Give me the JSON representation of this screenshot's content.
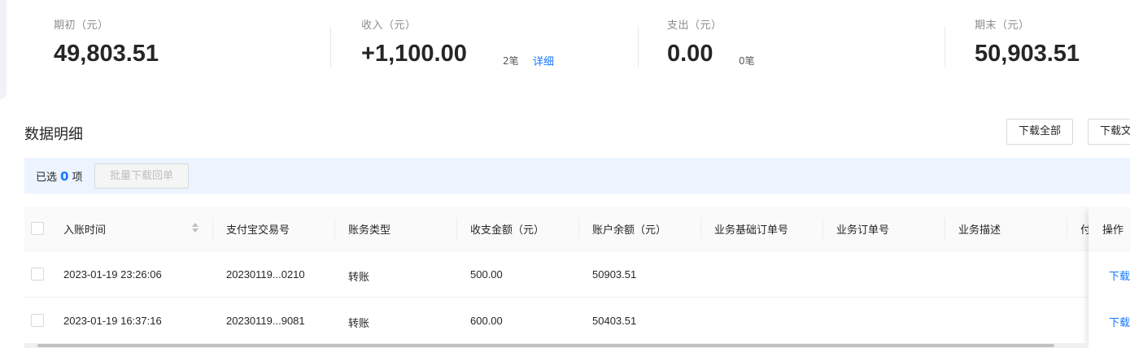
{
  "summary": {
    "opening": {
      "label": "期初（元）",
      "value": "49,803.51"
    },
    "income": {
      "label": "收入（元）",
      "value": "+1,100.00",
      "count": "2笔",
      "detail_link": "详细"
    },
    "expense": {
      "label": "支出（元）",
      "value": "0.00",
      "count": "0笔"
    },
    "closing": {
      "label": "期末（元）",
      "value": "50,903.51"
    }
  },
  "section": {
    "title": "数据明细",
    "download_all": "下载全部",
    "download_file": "下载文"
  },
  "selection": {
    "prefix": "已选",
    "count": "0",
    "suffix": "项",
    "batch_download": "批量下载回单"
  },
  "table": {
    "columns": [
      "入账时间",
      "支付宝交易号",
      "账务类型",
      "收支金额（元）",
      "账户余额（元）",
      "业务基础订单号",
      "业务订单号",
      "业务描述",
      "付",
      "操作"
    ],
    "rows": [
      {
        "time": "2023-01-19 23:26:06",
        "trade_no": "20230119...0210",
        "type": "转账",
        "amount": "500.00",
        "balance": "50903.51",
        "base_order": "",
        "order": "",
        "desc": "",
        "action": "下载"
      },
      {
        "time": "2023-01-19 16:37:16",
        "trade_no": "20230119...9081",
        "type": "转账",
        "amount": "600.00",
        "balance": "50403.51",
        "base_order": "",
        "order": "",
        "desc": "",
        "action": "下载"
      }
    ]
  },
  "colors": {
    "accent": "#1677ff",
    "selection_bg": "#ebf4ff"
  }
}
